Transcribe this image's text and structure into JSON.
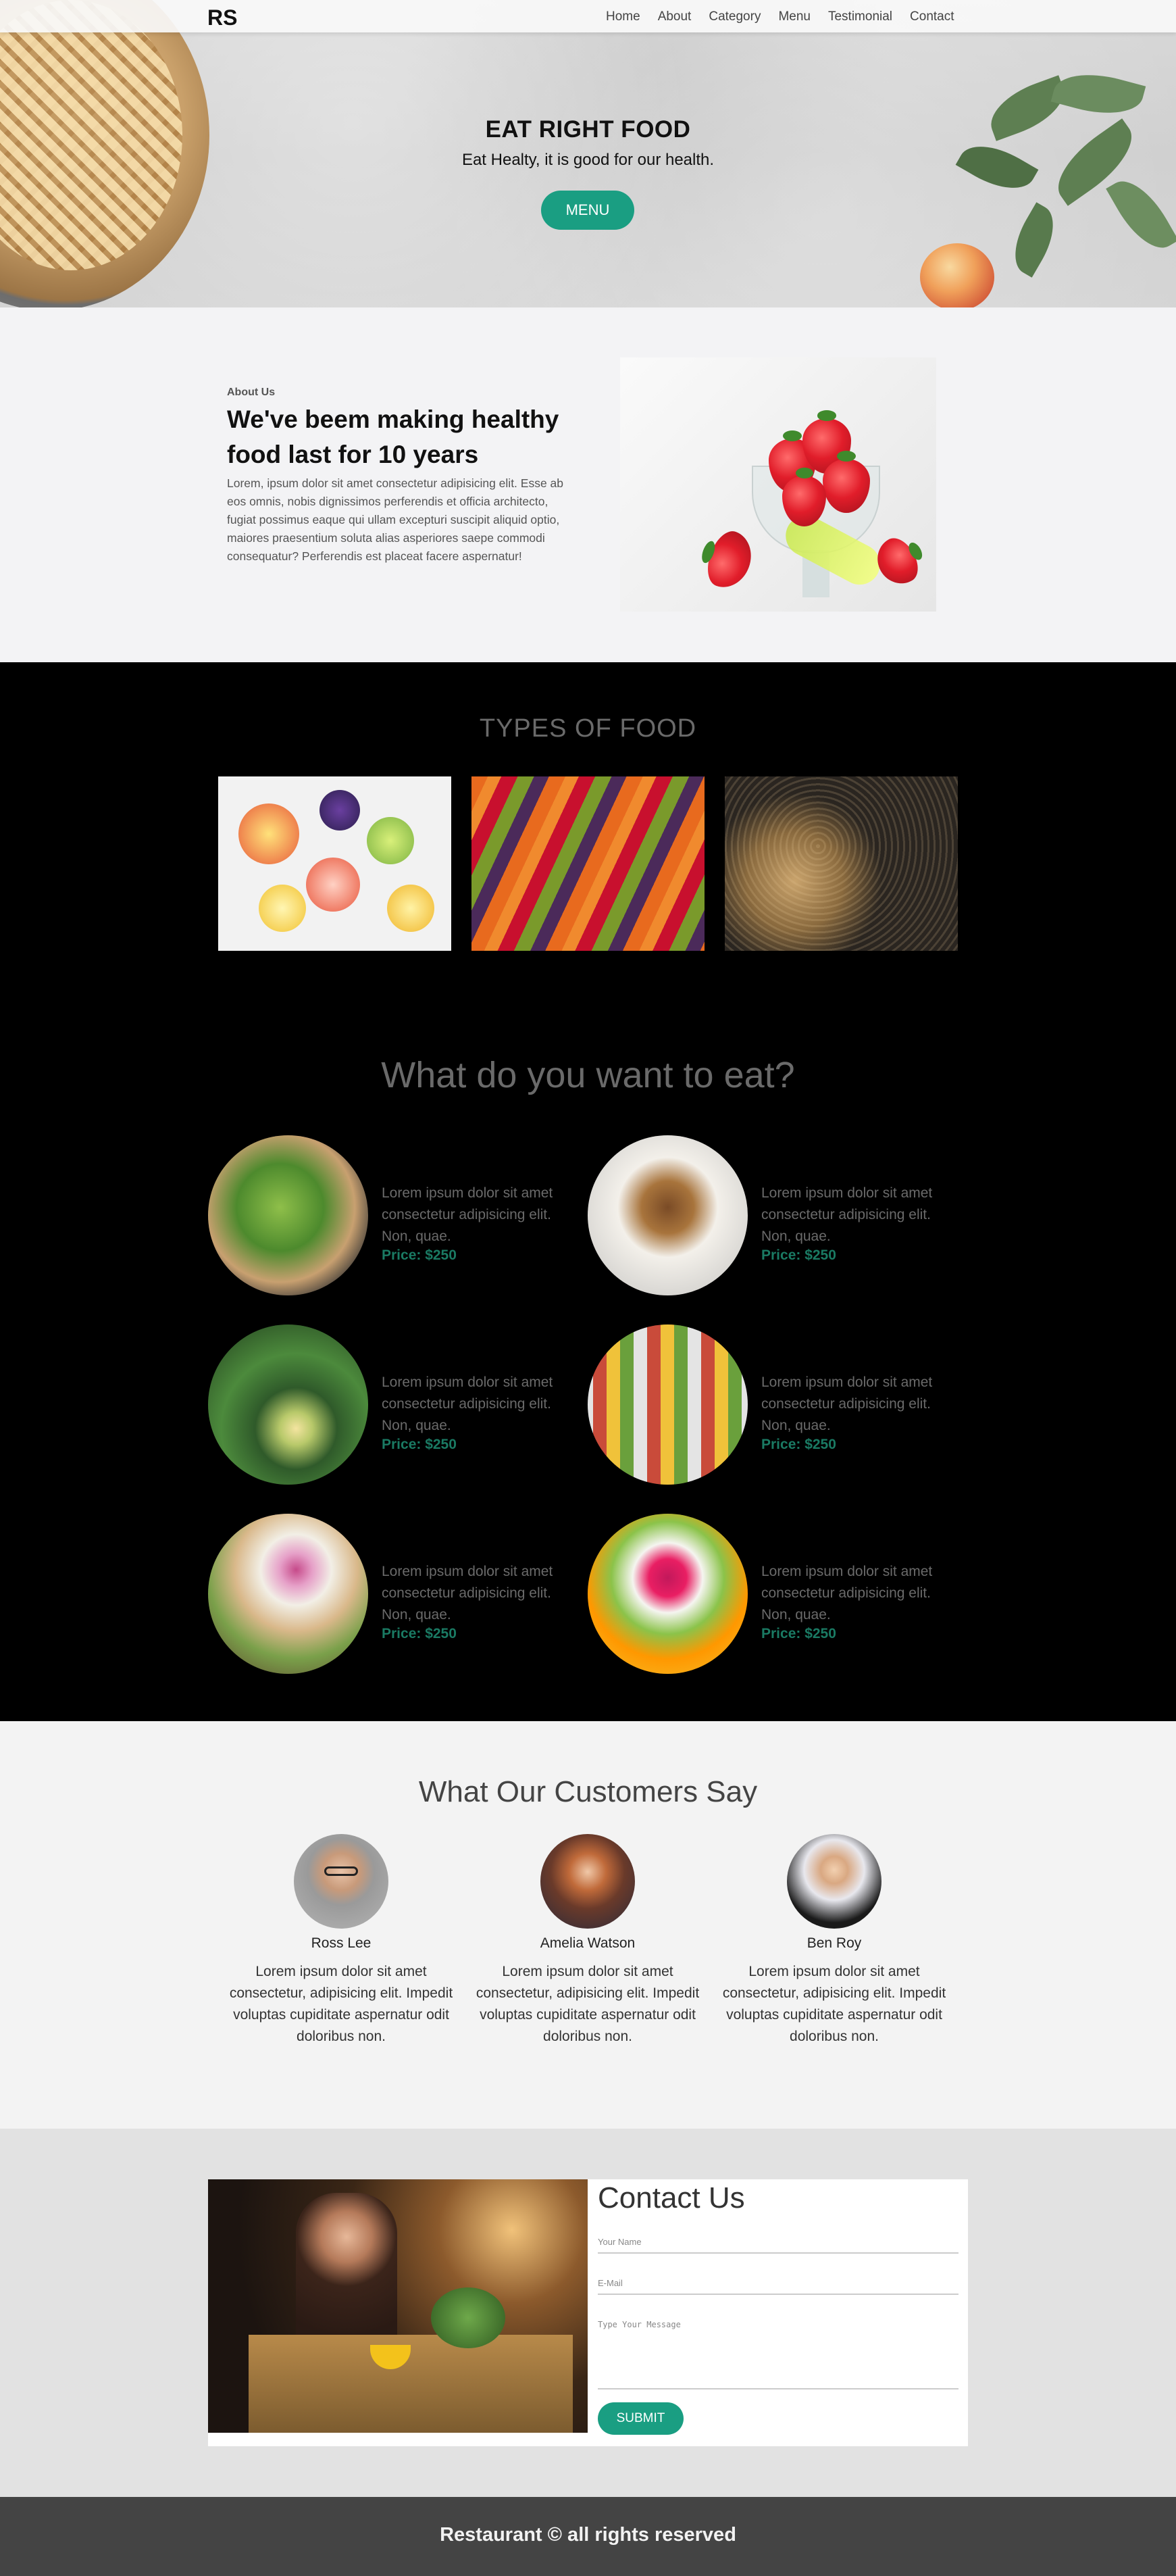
{
  "nav": {
    "logo": "RS",
    "links": [
      "Home",
      "About",
      "Category",
      "Menu",
      "Testimonial",
      "Contact"
    ]
  },
  "hero": {
    "title": "EAT RIGHT FOOD",
    "subtitle": "Eat Healty, it is good for our health.",
    "button": "MENU"
  },
  "about": {
    "kicker": "About Us",
    "heading": "We've beem making healthy food last for 10 years",
    "body": "Lorem, ipsum dolor sit amet consectetur adipisicing elit. Esse ab eos omnis, nobis dignissimos perferendis et officia architecto, fugiat possimus eaque qui ullam excepturi suscipit aliquid optio, maiores praesentium soluta alias asperiores saepe commodi consequatur? Perferendis est placeat facere aspernatur!"
  },
  "types": {
    "heading": "TYPES OF FOOD"
  },
  "menu": {
    "heading": "What do you want to eat?",
    "items": [
      {
        "desc": "Lorem ipsum dolor sit amet consectetur adipisicing elit. Non, quae.",
        "price": "Price: $250"
      },
      {
        "desc": "Lorem ipsum dolor sit amet consectetur adipisicing elit. Non, quae.",
        "price": "Price: $250"
      },
      {
        "desc": "Lorem ipsum dolor sit amet consectetur adipisicing elit. Non, quae.",
        "price": "Price: $250"
      },
      {
        "desc": "Lorem ipsum dolor sit amet consectetur adipisicing elit. Non, quae.",
        "price": "Price: $250"
      },
      {
        "desc": "Lorem ipsum dolor sit amet consectetur adipisicing elit. Non, quae.",
        "price": "Price: $250"
      },
      {
        "desc": "Lorem ipsum dolor sit amet consectetur adipisicing elit. Non, quae.",
        "price": "Price: $250"
      }
    ]
  },
  "testimonials": {
    "heading": "What Our Customers Say",
    "people": [
      {
        "name": "Ross Lee",
        "quote": "Lorem ipsum dolor sit amet consectetur, adipisicing elit. Impedit voluptas cupiditate aspernatur odit doloribus non."
      },
      {
        "name": "Amelia Watson",
        "quote": "Lorem ipsum dolor sit amet consectetur, adipisicing elit. Impedit voluptas cupiditate aspernatur odit doloribus non."
      },
      {
        "name": "Ben Roy",
        "quote": "Lorem ipsum dolor sit amet consectetur, adipisicing elit. Impedit voluptas cupiditate aspernatur odit doloribus non."
      }
    ]
  },
  "contact": {
    "heading": "Contact Us",
    "name_placeholder": "Your Name",
    "email_placeholder": "E-Mail",
    "message_placeholder": "Type Your Message",
    "submit": "SUBMIT"
  },
  "footer": {
    "text": "Restaurant © all rights reserved"
  },
  "colors": {
    "accent": "#1a9e82",
    "price": "#1a7a63",
    "dark_bg": "#000000",
    "footer_bg": "#444444"
  }
}
